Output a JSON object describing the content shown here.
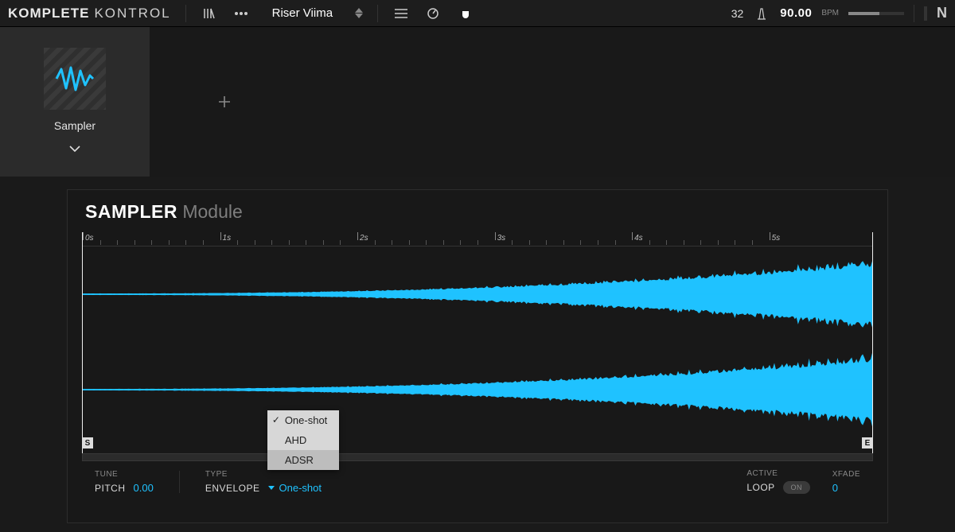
{
  "app": {
    "logo_bold": "KOMPLETE",
    "logo_thin": "KONTROL"
  },
  "header": {
    "preset_name": "Riser Viima",
    "tempo_sig": "32",
    "bpm": "90.00",
    "bpm_label": "BPM"
  },
  "module_tile": {
    "name": "Sampler"
  },
  "panel": {
    "title_bold": "SAMPLER",
    "title_thin": "Module",
    "ruler_labels": [
      "0s",
      "1s",
      "2s",
      "3s",
      "4s",
      "5s"
    ],
    "marker_start": "S",
    "marker_end": "E"
  },
  "params": {
    "tune_label": "TUNE",
    "pitch_label": "PITCH",
    "pitch_value": "0.00",
    "envelope_group": "TYPE",
    "envelope_label": "ENVELOPE",
    "envelope_value": "One-shot",
    "loop_label": "LOOP",
    "active_label": "ACTIVE",
    "loop_toggle": "ON",
    "xfade_label": "XFADE",
    "xfade_value": "0"
  },
  "dropdown": {
    "items": [
      "One-shot",
      "AHD",
      "ADSR"
    ],
    "selected_index": 0,
    "hover_index": 2
  },
  "colors": {
    "accent": "#1fc2ff"
  }
}
